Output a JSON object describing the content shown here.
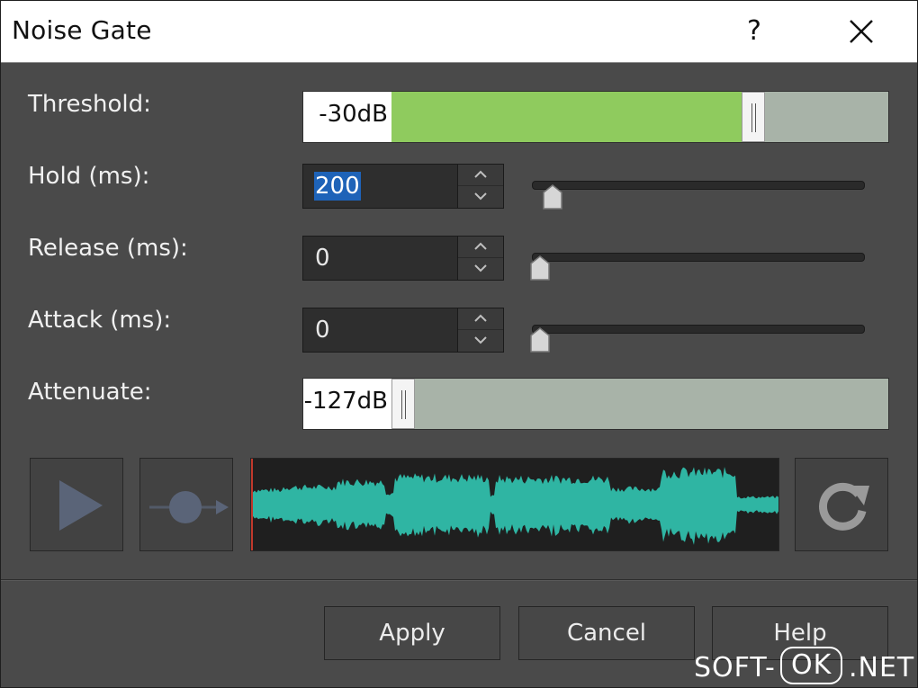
{
  "window": {
    "title": "Noise Gate",
    "help_glyph": "?",
    "close_icon": "close-icon"
  },
  "threshold": {
    "label": "Threshold:",
    "value": "-30dB",
    "level": 0.74
  },
  "hold": {
    "label": "Hold (ms):",
    "value": "200",
    "slider_level": 0.04
  },
  "release": {
    "label": "Release (ms):",
    "value": "0",
    "slider_level": 0.0
  },
  "attack": {
    "label": "Attack (ms):",
    "value": "0",
    "slider_level": 0.0
  },
  "attenuate": {
    "label": "Attenuate:",
    "value": "-127dB",
    "level": 0.0
  },
  "preview": {
    "play_icon": "play-icon",
    "record_icon": "record-icon",
    "loop_icon": "loop-icon"
  },
  "buttons": {
    "apply": "Apply",
    "cancel": "Cancel",
    "help": "Help"
  },
  "watermark": {
    "left": "SOFT-",
    "middle": "OK",
    "right": ".NET"
  },
  "colors": {
    "accent_green": "#8fcb5e",
    "waveform": "#2fb5a3",
    "selection": "#1e63b8"
  }
}
